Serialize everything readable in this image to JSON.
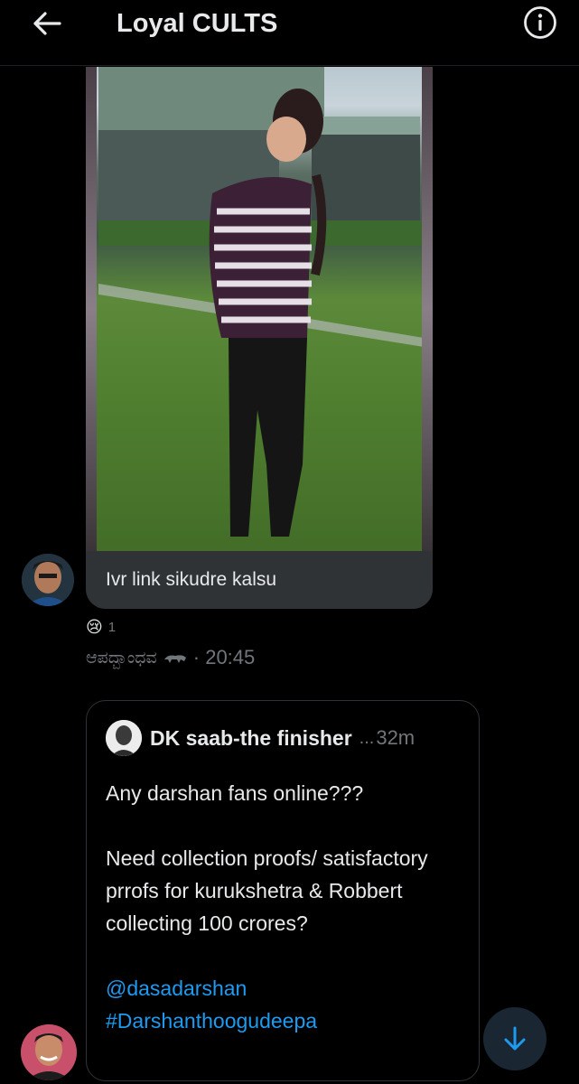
{
  "header": {
    "title": "Loyal CULTS"
  },
  "messages": [
    {
      "type": "media",
      "caption": "Ivr link sikudre kalsu",
      "reaction": {
        "emoji": "😢",
        "count": "1"
      },
      "sender": "ಆಪದ್ಬಾಂಧವ",
      "time": "· 20:45"
    },
    {
      "type": "shared_tweet",
      "author": "DK saab-the finisher",
      "ellipsis": "...",
      "age": "32m",
      "text_line1": "Any darshan fans online???",
      "text_line2": "Need collection proofs/ satisfactory prrofs for kurukshetra & Robbert collecting 100 crores?",
      "mention": "@dasadarshan",
      "hashtag": "#Darshanthoogudeepa"
    }
  ],
  "colors": {
    "background": "#000000",
    "bubble": "#2f3336",
    "link": "#1d9bf0",
    "muted": "#71767b"
  }
}
